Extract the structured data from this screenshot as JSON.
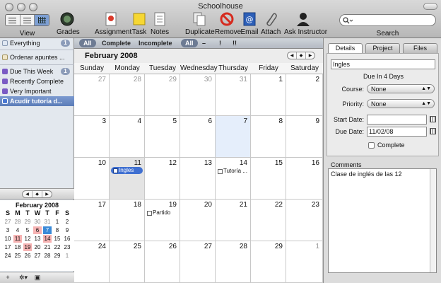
{
  "window": {
    "title": "Schoolhouse"
  },
  "toolbar": {
    "view_label": "View",
    "grades_label": "Grades",
    "assignment_label": "Assignment",
    "task_label": "Task",
    "notes_label": "Notes",
    "duplicate_label": "Duplicate",
    "remove_label": "Remove",
    "email_label": "Email",
    "attach_label": "Attach",
    "ask_label": "Ask Instructor",
    "search_label": "Search",
    "search_placeholder": ""
  },
  "sidebar": {
    "items": [
      {
        "label": "Everything",
        "badge": "1",
        "color": "#dfe7f2"
      },
      {
        "label": "Ordenar apuntes ...",
        "badge": "",
        "color": "#f0e6c8"
      },
      {
        "label": "Due This Week",
        "badge": "1",
        "color": "#7a5bc4"
      },
      {
        "label": "Recently Complete",
        "badge": "",
        "color": "#7a5bc4"
      },
      {
        "label": "Very Important",
        "badge": "",
        "color": "#7a5bc4"
      },
      {
        "label": "Acudir tutoría d...",
        "badge": "",
        "color": "#4a78d2"
      }
    ]
  },
  "mini_calendar": {
    "title": "February 2008",
    "weekdays": [
      "S",
      "M",
      "T",
      "W",
      "T",
      "F",
      "S"
    ],
    "rows": [
      [
        "27",
        "28",
        "29",
        "30",
        "31",
        "1",
        "2"
      ],
      [
        "3",
        "4",
        "5",
        "6",
        "7",
        "8",
        "9"
      ],
      [
        "10",
        "11",
        "12",
        "13",
        "14",
        "15",
        "16"
      ],
      [
        "17",
        "18",
        "19",
        "20",
        "21",
        "22",
        "23"
      ],
      [
        "24",
        "25",
        "26",
        "27",
        "28",
        "29",
        "1"
      ]
    ]
  },
  "filter": {
    "all": "All",
    "complete": "Complete",
    "incomplete": "Incomplete",
    "all2": "All",
    "dash": "–",
    "excl": "!",
    "excl2": "!!"
  },
  "calendar": {
    "month": "February 2008",
    "weekdays": [
      "Sunday",
      "Monday",
      "Tuesday",
      "Wednesday",
      "Thursday",
      "Friday",
      "Saturday"
    ],
    "rows": [
      [
        "27",
        "28",
        "29",
        "30",
        "31",
        "1",
        "2"
      ],
      [
        "3",
        "4",
        "5",
        "6",
        "7",
        "8",
        "9"
      ],
      [
        "10",
        "11",
        "12",
        "13",
        "14",
        "15",
        "16"
      ],
      [
        "17",
        "18",
        "19",
        "20",
        "21",
        "22",
        "23"
      ],
      [
        "24",
        "25",
        "26",
        "27",
        "28",
        "29",
        "1"
      ]
    ],
    "events": {
      "ingles": "Ingles",
      "tutoria": "Tutoría ...",
      "partido": "Partido"
    }
  },
  "inspector": {
    "tabs": [
      "Details",
      "Project",
      "Files"
    ],
    "title_value": "Ingles",
    "due_in": "Due In 4 Days",
    "course_label": "Course:",
    "course_value": "None",
    "priority_label": "Priority:",
    "priority_value": "None",
    "start_label": "Start Date:",
    "start_value": "",
    "due_label": "Due Date:",
    "due_value": "11/02/08",
    "complete_label": "Complete",
    "comments_label": "Comments",
    "comments_text": "Clase de inglés de las 12"
  }
}
